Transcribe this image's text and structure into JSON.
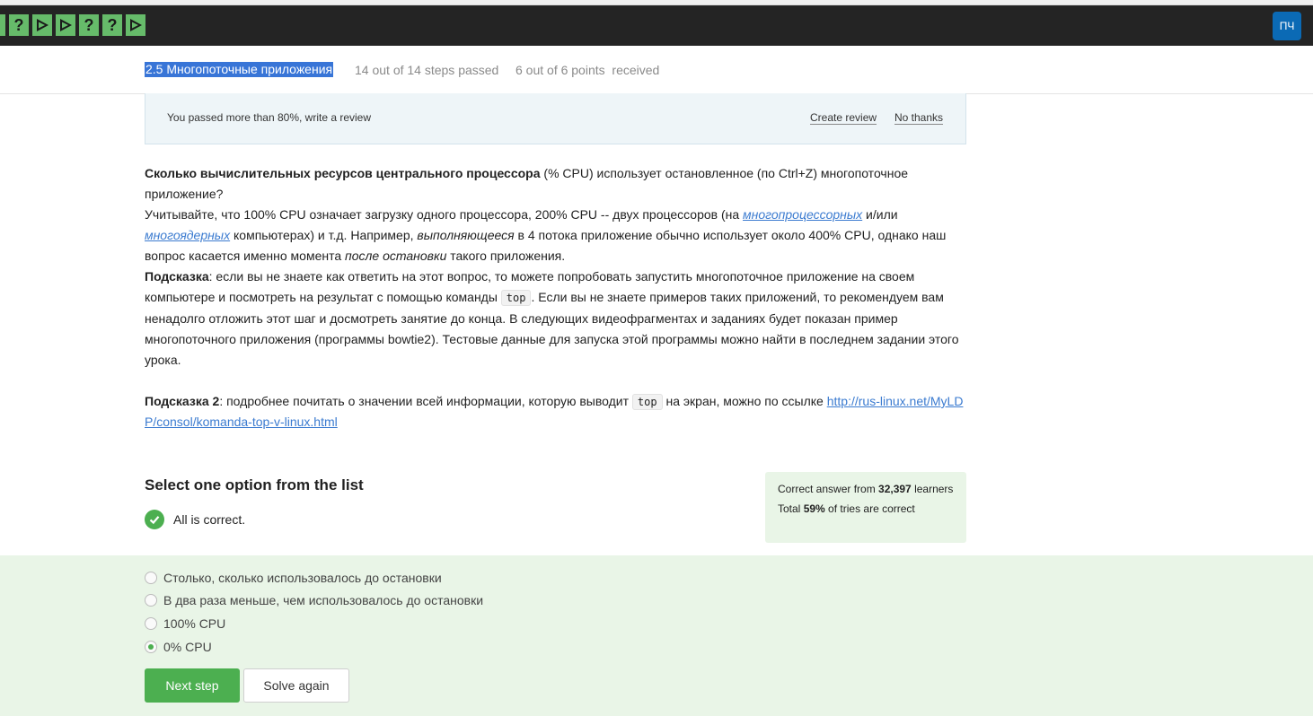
{
  "header": {
    "steps": [
      {
        "type": "play",
        "partial": true
      },
      {
        "type": "question"
      },
      {
        "type": "play"
      },
      {
        "type": "play"
      },
      {
        "type": "question"
      },
      {
        "type": "question"
      },
      {
        "type": "play"
      }
    ],
    "avatar": "ПЧ"
  },
  "lesson": {
    "title": "2.5 Многопоточные приложения",
    "progress": "14 out of 14 steps passed",
    "points": "6 out of 6 points  received"
  },
  "review": {
    "text": "You passed more than 80%, write a review",
    "create": "Create review",
    "dismiss": "No thanks"
  },
  "question": {
    "p1_bold": "Сколько вычислительных ресурсов центрального процессора",
    "p1_rest": " (% CPU) использует остановленное (по Ctrl+Z) многопоточное приложение?",
    "p2_a": "Учитывайте, что 100% CPU означает загрузку одного процессора, 200% CPU -- двух процессоров (на ",
    "p2_link1": "многопроцессорных",
    "p2_b": " и/или ",
    "p2_link2": "многоядерных",
    "p2_c": " компьютерах) и т.д. Например, ",
    "p2_em1": "выполняющееся",
    "p2_d": " в 4 потока приложение обычно использует около 400% CPU, однако наш вопрос касается именно момента ",
    "p2_em2": "после остановки",
    "p2_e": " такого приложения.",
    "hint1_label": "Подсказка",
    "hint1_a": ": если вы не знаете как ответить на этот вопрос, то можете попробовать запустить многопоточное приложение на своем компьютере и посмотреть на результат с помощью команды ",
    "hint1_code": "top",
    "hint1_b": ". Если вы не знаете примеров таких приложений, то рекомендуем вам ненадолго отложить этот шаг и досмотреть занятие до конца. В следующих видеофрагментах и заданиях будет показан пример многопоточного приложения (программы bowtie2). Тестовые данные для запуска этой программы можно найти в последнем задании этого урока.",
    "hint2_label": "Подсказка 2",
    "hint2_a": ": подробнее почитать о значении всей информации, которую выводит ",
    "hint2_code": "top",
    "hint2_b": " на экран, можно по ссылке ",
    "hint2_link": "http://rus-linux.net/MyLDP/consol/komanda-top-v-linux.html"
  },
  "quiz": {
    "title": "Select one option from the list",
    "result": "All is correct.",
    "stats_a": "Correct answer from ",
    "stats_learners": "32,397",
    "stats_b": " learners",
    "stats_total_a": "Total ",
    "stats_pct": "59%",
    "stats_total_b": " of tries are correct",
    "options": [
      {
        "label": "Столько, сколько использовалось до остановки",
        "selected": false
      },
      {
        "label": "В два раза меньше, чем использовалось до остановки",
        "selected": false
      },
      {
        "label": "100% CPU",
        "selected": false
      },
      {
        "label": "0% CPU",
        "selected": true
      }
    ],
    "next": "Next step",
    "solve_again": "Solve again"
  }
}
